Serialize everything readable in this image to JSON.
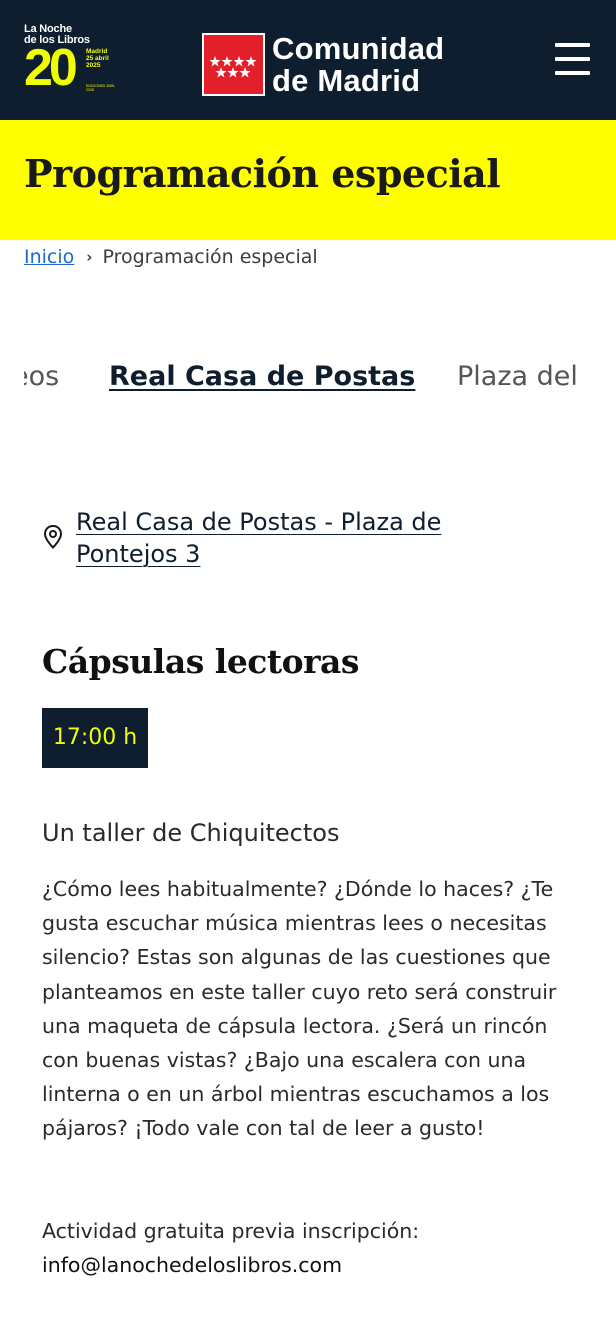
{
  "header": {
    "festival_logo": {
      "line1": "La Noche",
      "line2": "de los Libros",
      "number": "20",
      "city": "Madrid",
      "date": "25 abril",
      "year": "2025",
      "editions": "EDICIONES 2005-2025"
    },
    "brand_line1": "Comunidad",
    "brand_line2": "de Madrid",
    "menu_icon": "hamburger-icon",
    "colors": {
      "header_bg": "#0f1e2e",
      "accent_yellow": "#f0ff00",
      "flag_red": "#e3202a"
    }
  },
  "title_band": {
    "title": "Programación especial",
    "background": "#ffff00"
  },
  "breadcrumb": {
    "home": "Inicio",
    "current": "Programación especial"
  },
  "tabs": [
    {
      "label": "eos",
      "active": false
    },
    {
      "label": "Real Casa de Postas",
      "active": true
    },
    {
      "label": "Plaza del",
      "active": false
    }
  ],
  "location": {
    "icon": "map-pin-icon",
    "line1": "Real Casa de Postas - Plaza de",
    "line2": "Pontejos 3"
  },
  "event": {
    "title": "Cápsulas lectoras",
    "time": "17:00 h",
    "subtitle": "Un taller de Chiquitectos",
    "description": "¿Cómo lees habitualmente? ¿Dónde lo haces? ¿Te gusta escuchar música mientras lees o necesitas silencio? Estas son algunas de las cuestiones que planteamos en este taller cuyo reto será construir una maqueta de cápsula lectora. ¿Será un rincón con buenas vistas? ¿Bajo una escalera con una linterna o en un árbol mientras escuchamos a los pájaros? ¡Todo vale con tal de leer a gusto!",
    "note": "Actividad gratuita previa inscripción:",
    "email": "info@lanochedeloslibros.com"
  }
}
